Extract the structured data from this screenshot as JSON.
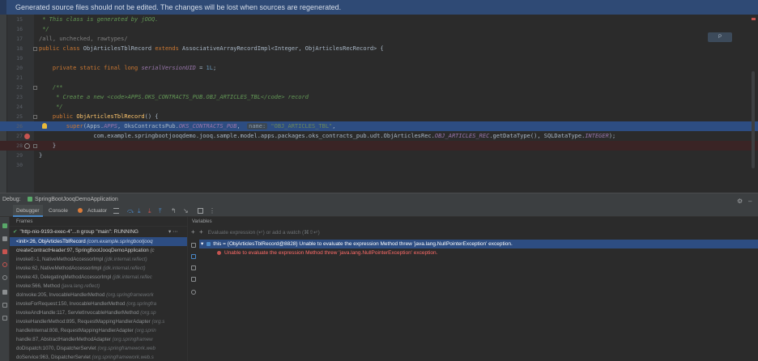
{
  "banner": {
    "text": "Generated source files should not be edited. The changes will be lost when sources are regenerated."
  },
  "editor": {
    "badge": "P",
    "lines": [
      {
        "n": "15",
        "parts": [
          [
            "cmt",
            " * This class is generated by jOOQ."
          ]
        ]
      },
      {
        "n": "16",
        "parts": [
          [
            "cmt",
            " */"
          ]
        ]
      },
      {
        "n": "17",
        "parts": [
          [
            "cmtg",
            "/all, unchecked, rawtypes/"
          ]
        ]
      },
      {
        "n": "18",
        "parts": [
          [
            "kw",
            "public class "
          ],
          [
            "",
            "ObjArticlesTblRecord "
          ],
          [
            "kw",
            "extends "
          ],
          [
            "",
            "AssociativeArrayRecordImpl<Integer, ObjArticlesRecRecord> {"
          ]
        ]
      },
      {
        "n": "19",
        "parts": []
      },
      {
        "n": "20",
        "parts": [
          [
            "kw",
            "    private static final long "
          ],
          [
            "fld",
            "serialVersionUID"
          ],
          [
            "",
            " = "
          ],
          [
            "num",
            "1L"
          ],
          [
            "",
            ";"
          ]
        ]
      },
      {
        "n": "21",
        "parts": []
      },
      {
        "n": "22",
        "parts": [
          [
            "cmt",
            "    /**"
          ]
        ]
      },
      {
        "n": "23",
        "parts": [
          [
            "cmt",
            "     * Create a new <code>APPS.OKS_CONTRACTS_PUB.OBJ_ARTICLES_TBL</code> record"
          ]
        ]
      },
      {
        "n": "24",
        "parts": [
          [
            "cmt",
            "     */"
          ]
        ]
      },
      {
        "n": "25",
        "parts": [
          [
            "kw",
            "    public "
          ],
          [
            "fn",
            "ObjArticlesTblRecord"
          ],
          [
            "",
            "() {"
          ]
        ]
      },
      {
        "n": "26",
        "parts": [
          [
            "kw",
            "        super"
          ],
          [
            "",
            "(Apps."
          ],
          [
            "fld",
            "APPS"
          ],
          [
            "",
            ", OksContractsPub."
          ],
          [
            "fld",
            "OKS_CONTRACTS_PUB"
          ],
          [
            "",
            ",  "
          ],
          [
            "hint",
            "name:"
          ],
          [
            "str",
            " \"OBJ_ARTICLES_TBL\""
          ],
          [
            "",
            ","
          ]
        ]
      },
      {
        "n": "27",
        "parts": [
          [
            "",
            "                com.example.springbootjooqdemo.jooq.sample.model.apps.packages.oks_contracts_pub.udt.ObjArticlesRec."
          ],
          [
            "fld",
            "OBJ_ARTICLES_REC"
          ],
          [
            "",
            ".getDataType(), SQLDataType."
          ],
          [
            "fld",
            "INTEGER"
          ],
          [
            "",
            ");"
          ]
        ]
      },
      {
        "n": "28",
        "parts": [
          [
            "",
            "    }"
          ]
        ]
      },
      {
        "n": "29",
        "parts": [
          [
            "",
            "}"
          ]
        ]
      },
      {
        "n": "30",
        "parts": []
      }
    ]
  },
  "debug": {
    "title": "Debug:",
    "session": "SpringBootJooqDemoApplication",
    "tabs": [
      "Debugger",
      "Console",
      "Actuator"
    ],
    "frames_header": "Frames",
    "variables_header": "Variables",
    "thread": "\"http-nio-9193-exec-4\"...n group \"main\": RUNNING",
    "frames": [
      {
        "text": "<init>:26, ObjArticlesTblRecord ",
        "pkg": "(com.example.springbootjooq",
        "kind": "sel"
      },
      {
        "text": "createContractHeader:97, SpringBootJooqDemoApplication ",
        "pkg": "(c",
        "kind": "app"
      },
      {
        "text": "invoke0:-1, NativeMethodAccessorImpl ",
        "pkg": "(jdk.internal.reflect)",
        "kind": ""
      },
      {
        "text": "invoke:62, NativeMethodAccessorImpl ",
        "pkg": "(jdk.internal.reflect)",
        "kind": ""
      },
      {
        "text": "invoke:43, DelegatingMethodAccessorImpl ",
        "pkg": "(jdk.internal.reflec",
        "kind": ""
      },
      {
        "text": "invoke:566, Method ",
        "pkg": "(java.lang.reflect)",
        "kind": ""
      },
      {
        "text": "doInvoke:205, InvocableHandlerMethod ",
        "pkg": "(org.springframework",
        "kind": ""
      },
      {
        "text": "invokeForRequest:150, InvocableHandlerMethod ",
        "pkg": "(org.springfra",
        "kind": ""
      },
      {
        "text": "invokeAndHandle:117, ServletInvocableHandlerMethod ",
        "pkg": "(org.sp",
        "kind": ""
      },
      {
        "text": "invokeHandlerMethod:895, RequestMappingHandlerAdapter ",
        "pkg": "(org.s",
        "kind": ""
      },
      {
        "text": "handleInternal:808, RequestMappingHandlerAdapter ",
        "pkg": "(org.sprin",
        "kind": ""
      },
      {
        "text": "handle:87, AbstractHandlerMethodAdapter ",
        "pkg": "(org.springframew",
        "kind": ""
      },
      {
        "text": "doDispatch:1070, DispatcherServlet ",
        "pkg": "(org.springframework.web",
        "kind": ""
      },
      {
        "text": "doService:963, DispatcherServlet ",
        "pkg": "(org.springframework.web.s",
        "kind": ""
      }
    ],
    "eval_placeholder": "Evaluate expression (↵) or add a watch (⌘⇧↵)",
    "var_this": "this = {ObjArticlesTblRecord@8828} Unable to evaluate the expression Method threw 'java.lang.NullPointerException' exception.",
    "var_error": "Unable to evaluate the expression Method threw 'java.lang.NullPointerException' exception."
  }
}
